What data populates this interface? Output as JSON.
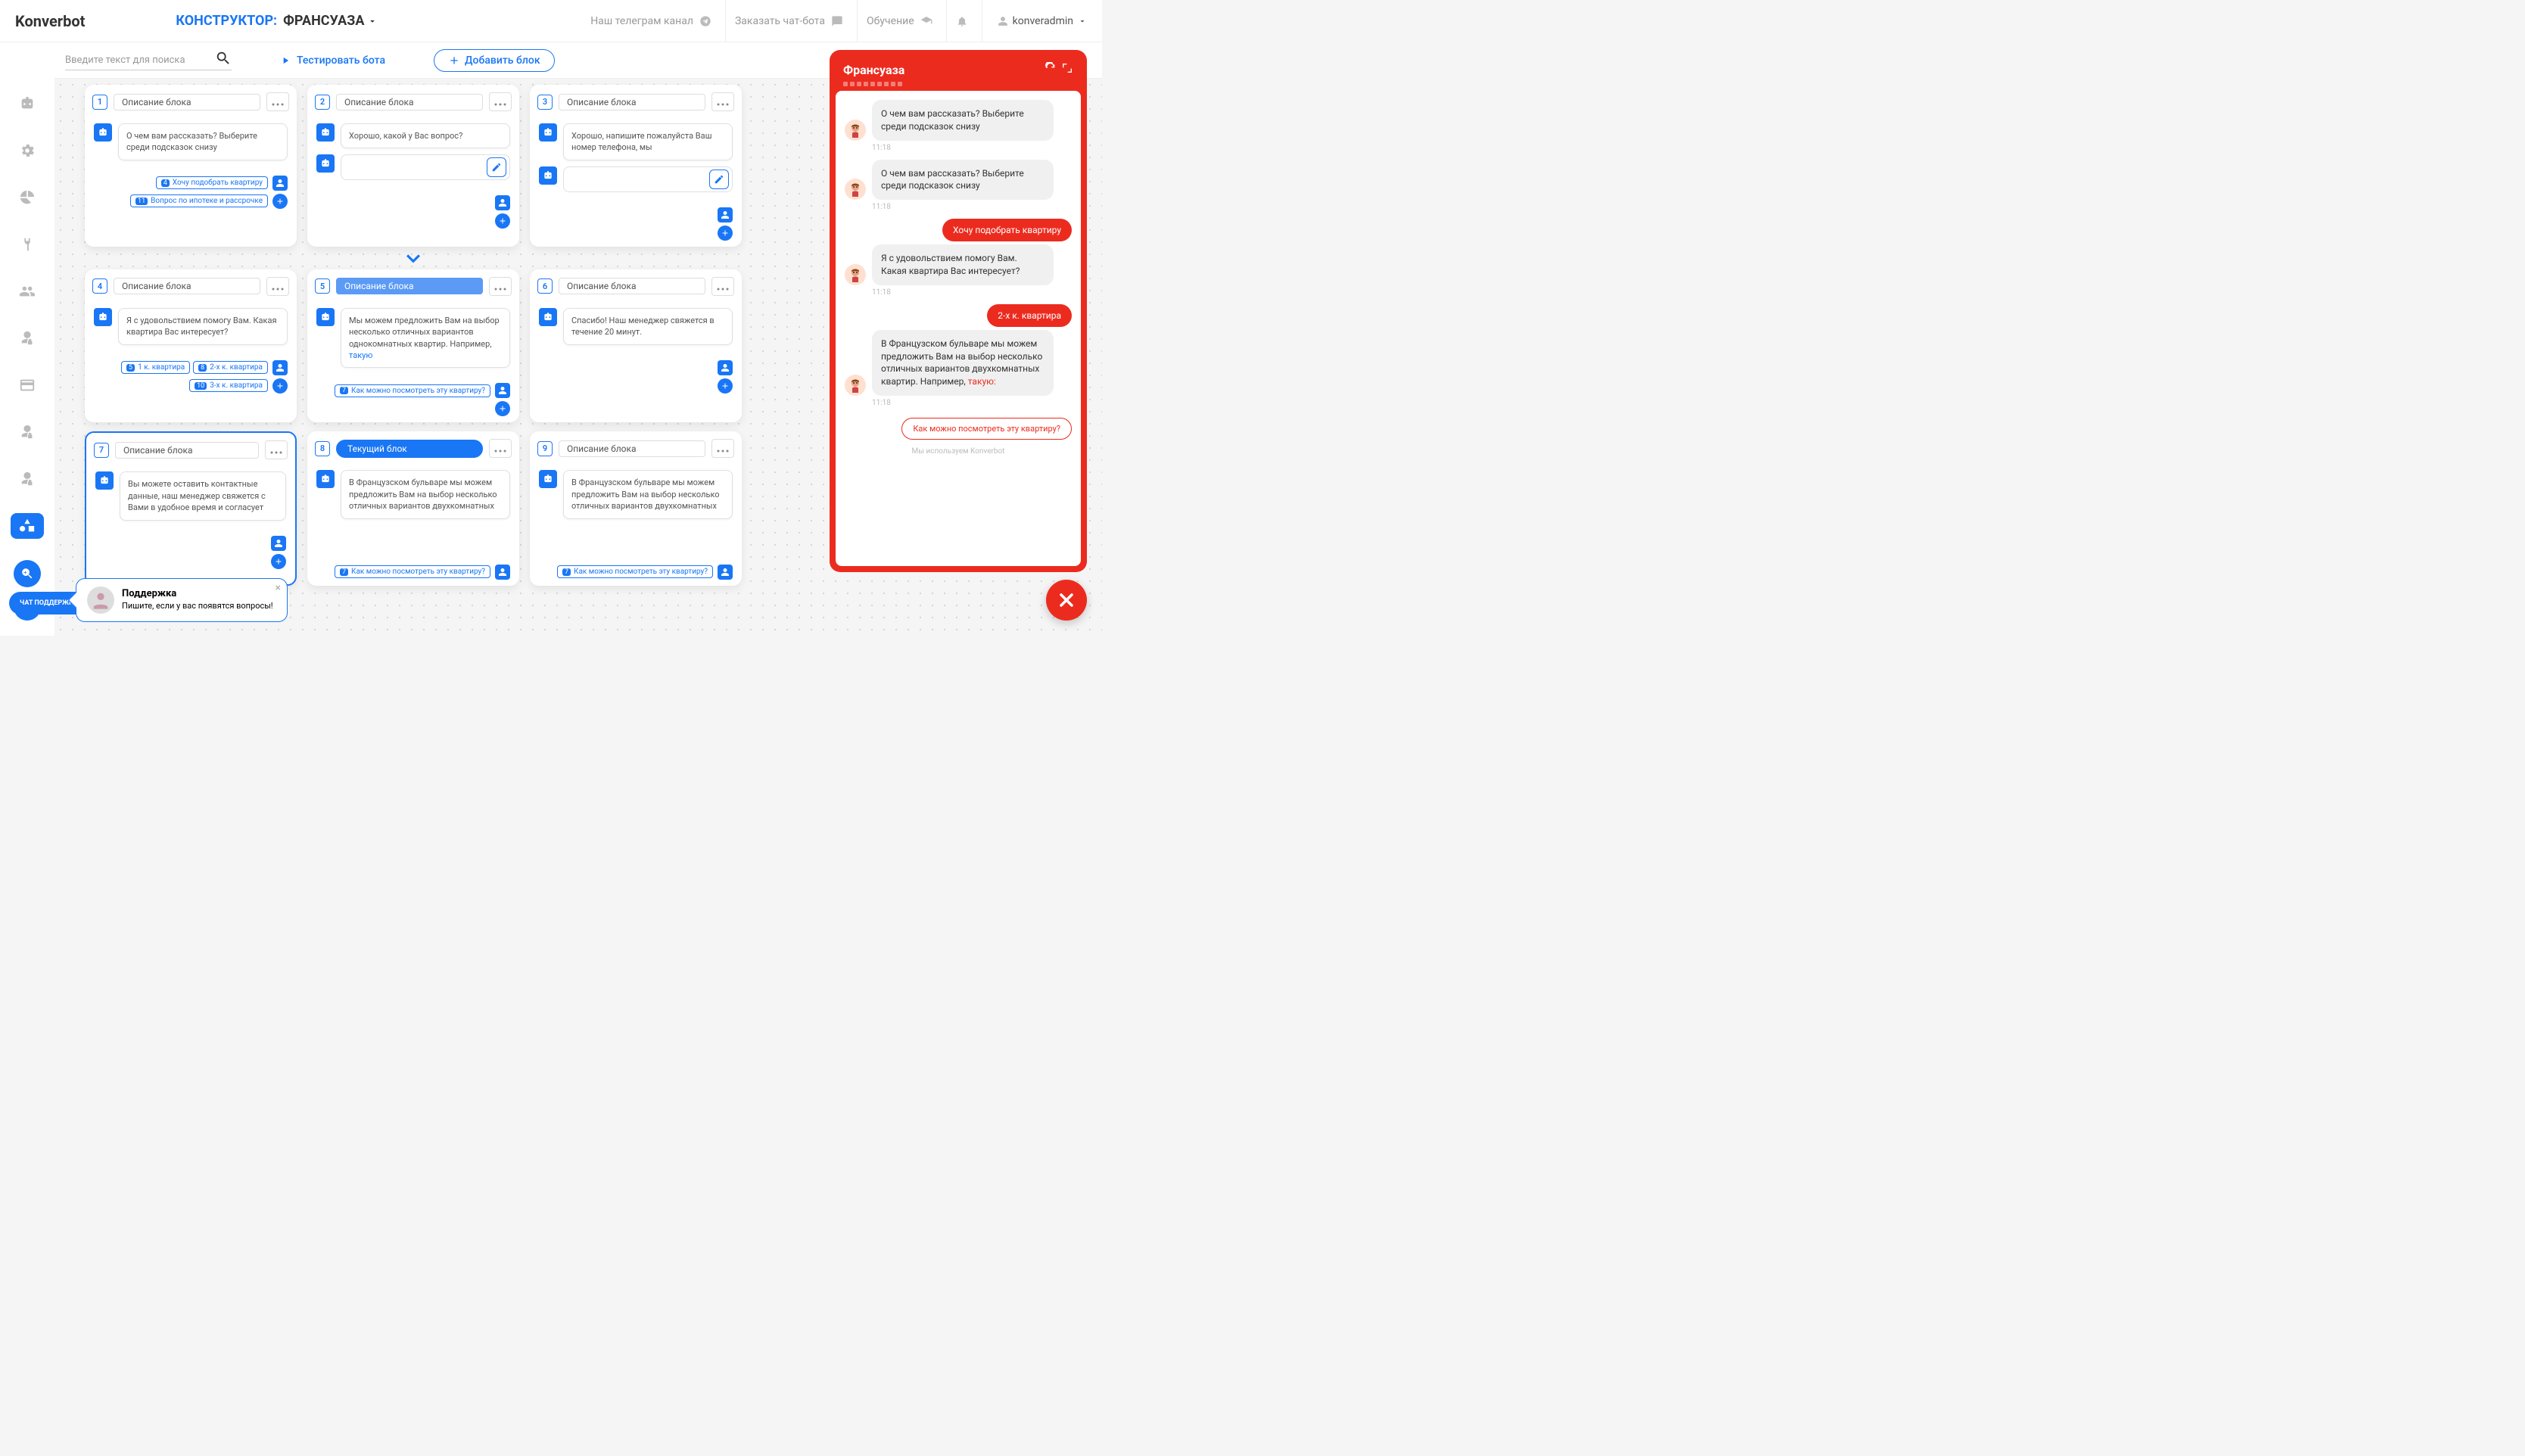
{
  "header": {
    "logo": "Konverbot",
    "constructor_label": "КОНСТРУКТОР:",
    "bot_name": "ФРАНСУАЗА",
    "links": {
      "telegram": "Наш телеграм канал",
      "order": "Заказать чат-бота",
      "training": "Обучение"
    },
    "user": "konveradmin"
  },
  "toolbar": {
    "search_placeholder": "Введите текст для поиска",
    "test_label": "Тестировать бота",
    "add_block_label": "Добавить блок"
  },
  "blocks": [
    {
      "num": "1",
      "title": "Описание блока",
      "msg": "О чем вам рассказать? Выберите среди подсказок снизу",
      "chips": [
        {
          "n": "4",
          "t": "Хочу подобрать квартиру"
        },
        {
          "n": "11",
          "t": "Вопрос по ипотеке и рассрочке"
        }
      ]
    },
    {
      "num": "2",
      "title": "Описание блока",
      "msg": "Хорошо, какой у Вас вопрос?",
      "empty_input": true
    },
    {
      "num": "3",
      "title": "Описание блока",
      "msg": "Хорошо, напишите пожалуйста Ваш номер телефона, мы",
      "empty_input": true
    },
    {
      "num": "4",
      "title": "Описание блока",
      "msg": "Я с удовольствием помогу Вам. Какая квартира Вас интересует?",
      "chips": [
        {
          "n": "5",
          "t": "1 к. квартира"
        },
        {
          "n": "8",
          "t": "2-х к. квартира"
        },
        {
          "n": "10",
          "t": "3-х к. квартира"
        }
      ]
    },
    {
      "num": "5",
      "title": "Описание блока",
      "title_style": "blue",
      "msg_html": "Мы можем предложить Вам на выбор несколько отличных вариантов однокомнатных квартир. Например, <a>такую</a>",
      "chips": [
        {
          "n": "7",
          "t": "Как можно посмотреть эту квартиру?"
        }
      ]
    },
    {
      "num": "6",
      "title": "Описание блока",
      "msg": "Спасибо! Наш менеджер свяжется в течение 20 минут."
    },
    {
      "num": "7",
      "title": "Описание блока",
      "selected": true,
      "msg": "Вы можете оставить контактные данные, наш менеджер свяжется с Вами в удобное время и согласует",
      "chips_bottom_hidden": true
    },
    {
      "num": "8",
      "title": "Текущий блок",
      "title_style": "active",
      "msg": "В Французском бульваре мы можем предложить Вам на выбор несколько отличных вариантов двухкомнатных",
      "chips": [
        {
          "n": "7",
          "t": "Как можно посмотреть эту квартиру?"
        }
      ],
      "chips_pos": "bottom"
    },
    {
      "num": "9",
      "title": "Описание блока",
      "msg": "В Французском бульваре мы можем предложить Вам на выбор несколько отличных вариантов двухкомнатных",
      "chips": [
        {
          "n": "7",
          "t": "Как можно посмотреть эту квартиру?"
        }
      ],
      "chips_pos": "bottom"
    }
  ],
  "chat": {
    "title": "Франсуаза",
    "messages": [
      {
        "type": "bot",
        "text": "О чем вам рассказать? Выберите среди подсказок снизу",
        "time": "11:18"
      },
      {
        "type": "bot",
        "text": "О чем вам рассказать? Выберите среди подсказок снизу",
        "time": "11:18"
      },
      {
        "type": "user",
        "text": "Хочу подобрать квартиру"
      },
      {
        "type": "bot",
        "text": "Я с удовольствием помогу Вам. Какая квартира Вас интересует?",
        "time": "11:18"
      },
      {
        "type": "user",
        "text": "2-х к. квартира"
      },
      {
        "type": "bot",
        "html": "В Французском бульваре мы можем предложить Вам на выбор несколько отличных вариантов двухкомнатных квартир. Например, <a>такую:</a>",
        "time": "11:18"
      }
    ],
    "suggest": "Как можно посмотреть эту квартиру?",
    "footer": "Мы используем Konverbot"
  },
  "support": {
    "chip": "ЧАТ ПОДДЕРЖКИ",
    "title": "Поддержка",
    "text": "Пишите, если у вас появятся вопросы!"
  }
}
